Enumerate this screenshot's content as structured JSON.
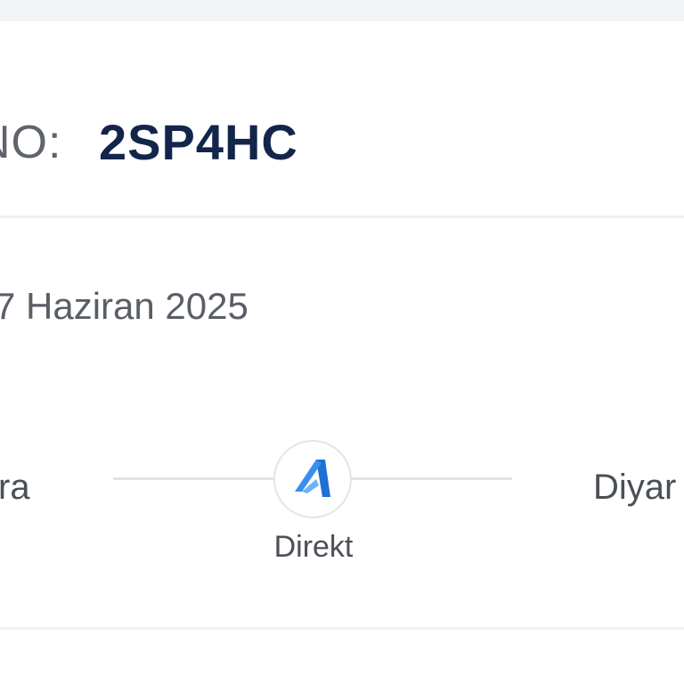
{
  "booking": {
    "pnr_label": "NO:",
    "pnr_code": "2SP4HC"
  },
  "flight": {
    "date": "7 Haziran 2025",
    "origin": "ra",
    "destination": "Diyar",
    "stop_type": "Direkt",
    "airline_icon": "airline-logo-icon"
  },
  "colors": {
    "pnr_code": "#13254a",
    "logo_blue": "#2b7de0",
    "route_line": "#dfe2e7"
  }
}
